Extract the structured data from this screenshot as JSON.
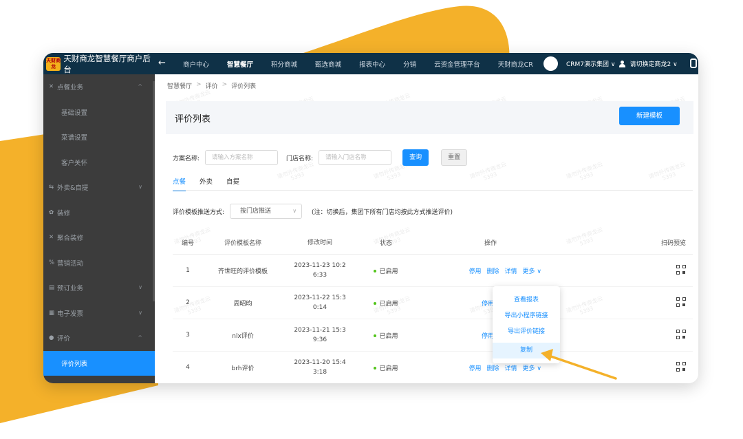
{
  "colors": {
    "accent": "#f4b12a",
    "topnav": "#0f3147",
    "sidebar": "#3c3c3c",
    "primary": "#1890ff",
    "status_on": "#52c41a"
  },
  "brand": {
    "logo_text": "天财商龙",
    "title": "天财商龙智慧餐厅商户后台"
  },
  "topnav": {
    "items": [
      "商户中心",
      "智慧餐厅",
      "积分商城",
      "甄选商城",
      "报表中心",
      "分销",
      "云资金管理平台",
      "天财商龙CR"
    ],
    "active_index": 1,
    "group_select": "CRM7演示集团 ∨",
    "store_select": "请切换定商龙2 ∨"
  },
  "sidebar": {
    "items": [
      {
        "label": "点餐业务",
        "icon": "✕",
        "chevron": "^",
        "sub": false,
        "active": false
      },
      {
        "label": "基础设置",
        "icon": "",
        "chevron": "",
        "sub": true,
        "active": false
      },
      {
        "label": "菜谱设置",
        "icon": "",
        "chevron": "",
        "sub": true,
        "active": false
      },
      {
        "label": "客户关怀",
        "icon": "",
        "chevron": "",
        "sub": true,
        "active": false
      },
      {
        "label": "外卖&自提",
        "icon": "⇆",
        "chevron": "∨",
        "sub": false,
        "active": false
      },
      {
        "label": "装修",
        "icon": "✿",
        "chevron": "",
        "sub": false,
        "active": false
      },
      {
        "label": "聚合装修",
        "icon": "✕",
        "chevron": "",
        "sub": false,
        "active": false
      },
      {
        "label": "营销活动",
        "icon": "%",
        "chevron": "",
        "sub": false,
        "active": false
      },
      {
        "label": "预订业务",
        "icon": "▤",
        "chevron": "∨",
        "sub": false,
        "active": false
      },
      {
        "label": "电子发票",
        "icon": "▦",
        "chevron": "∨",
        "sub": false,
        "active": false
      },
      {
        "label": "评价",
        "icon": "●",
        "chevron": "^",
        "sub": false,
        "active": false
      },
      {
        "label": "评价列表",
        "icon": "",
        "chevron": "",
        "sub": true,
        "active": true
      }
    ]
  },
  "breadcrumb": [
    "智慧餐厅",
    "评价",
    "评价列表"
  ],
  "panel": {
    "title": "评价列表",
    "new_button": "新建模板"
  },
  "filters": {
    "plan_label": "方案名称:",
    "plan_placeholder": "请输入方案名称",
    "store_label": "门店名称:",
    "store_placeholder": "请输入门店名称",
    "query_button": "查询",
    "reset_button": "重置"
  },
  "tabs": [
    "点餐",
    "外卖",
    "自提"
  ],
  "push": {
    "label": "评价模板推送方式:",
    "value": "按门店推送",
    "note": "(注：切换后，集团下所有门店均按此方式推送评价)"
  },
  "table": {
    "headers": [
      "编号",
      "评价模板名称",
      "修改时间",
      "状态",
      "操作",
      "扫码预览"
    ],
    "rows": [
      {
        "id": "1",
        "name": "齐世旺的评价模板",
        "time1": "2023-11-23 10:2",
        "time2": "6:33",
        "status": "已启用",
        "ops": [
          "停用",
          "删除",
          "详情",
          "更多 ∨"
        ]
      },
      {
        "id": "2",
        "name": "周昭昀",
        "time1": "2023-11-22 15:3",
        "time2": "0:14",
        "status": "已启用",
        "ops": [
          "停用"
        ]
      },
      {
        "id": "3",
        "name": "nlx评价",
        "time1": "2023-11-21 15:3",
        "time2": "9:36",
        "status": "已启用",
        "ops": [
          "停用"
        ]
      },
      {
        "id": "4",
        "name": "brh评价",
        "time1": "2023-11-20 15:4",
        "time2": "3:18",
        "status": "已启用",
        "ops": [
          "停用",
          "删除",
          "详情",
          "更多 ∨"
        ]
      }
    ]
  },
  "dropdown": [
    "查看报表",
    "导出小程序链接",
    "导出评价链接",
    "复制"
  ],
  "watermark": {
    "line1": "请勿外传商龙云",
    "line2": "5393"
  }
}
